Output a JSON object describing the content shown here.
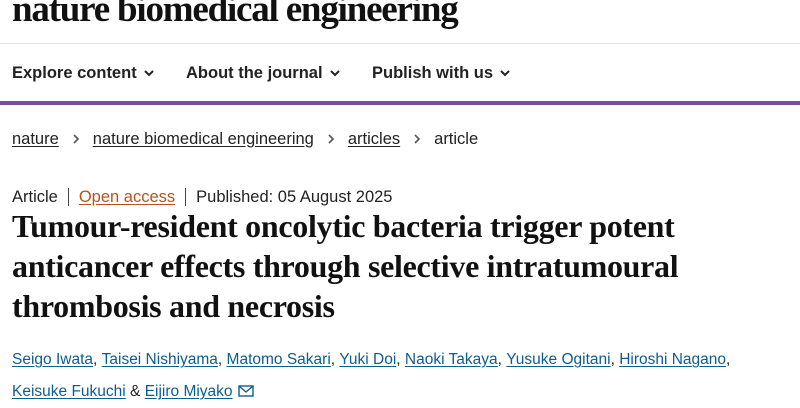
{
  "header": {
    "brand": "nature biomedical engineering"
  },
  "nav": {
    "items": [
      {
        "label": "Explore content",
        "icon": "chevron-down-icon"
      },
      {
        "label": "About the journal",
        "icon": "chevron-down-icon"
      },
      {
        "label": "Publish with us",
        "icon": "chevron-down-icon"
      }
    ],
    "accent_color": "#7b4d9c"
  },
  "breadcrumb": {
    "items": [
      "nature",
      "nature biomedical engineering",
      "articles"
    ],
    "current": "article",
    "separator_icon": "chevron-right-icon"
  },
  "article": {
    "type": "Article",
    "access": "Open access",
    "access_color": "#b3541e",
    "published": "Published: 05 August 2025",
    "title": "Tumour-resident oncolytic bacteria trigger potent anticancer effects through selective intratumoural thrombosis and necrosis"
  },
  "authors": {
    "link_color": "#0c5e8e",
    "list": [
      {
        "name": "Seigo Iwata",
        "suffix": ", "
      },
      {
        "name": "Taisei Nishiyama",
        "suffix": ", "
      },
      {
        "name": "Matomo Sakari",
        "suffix": ", "
      },
      {
        "name": "Yuki Doi",
        "suffix": ", "
      },
      {
        "name": "Naoki Takaya",
        "suffix": ", "
      },
      {
        "name": "Yusuke Ogitani",
        "suffix": ", "
      },
      {
        "name": "Hiroshi Nagano",
        "suffix": ","
      },
      {
        "name": "Keisuke Fukuchi",
        "suffix": " & "
      },
      {
        "name": "Eijiro Miyako",
        "suffix": ""
      }
    ],
    "contact_icon": "mail-icon"
  }
}
